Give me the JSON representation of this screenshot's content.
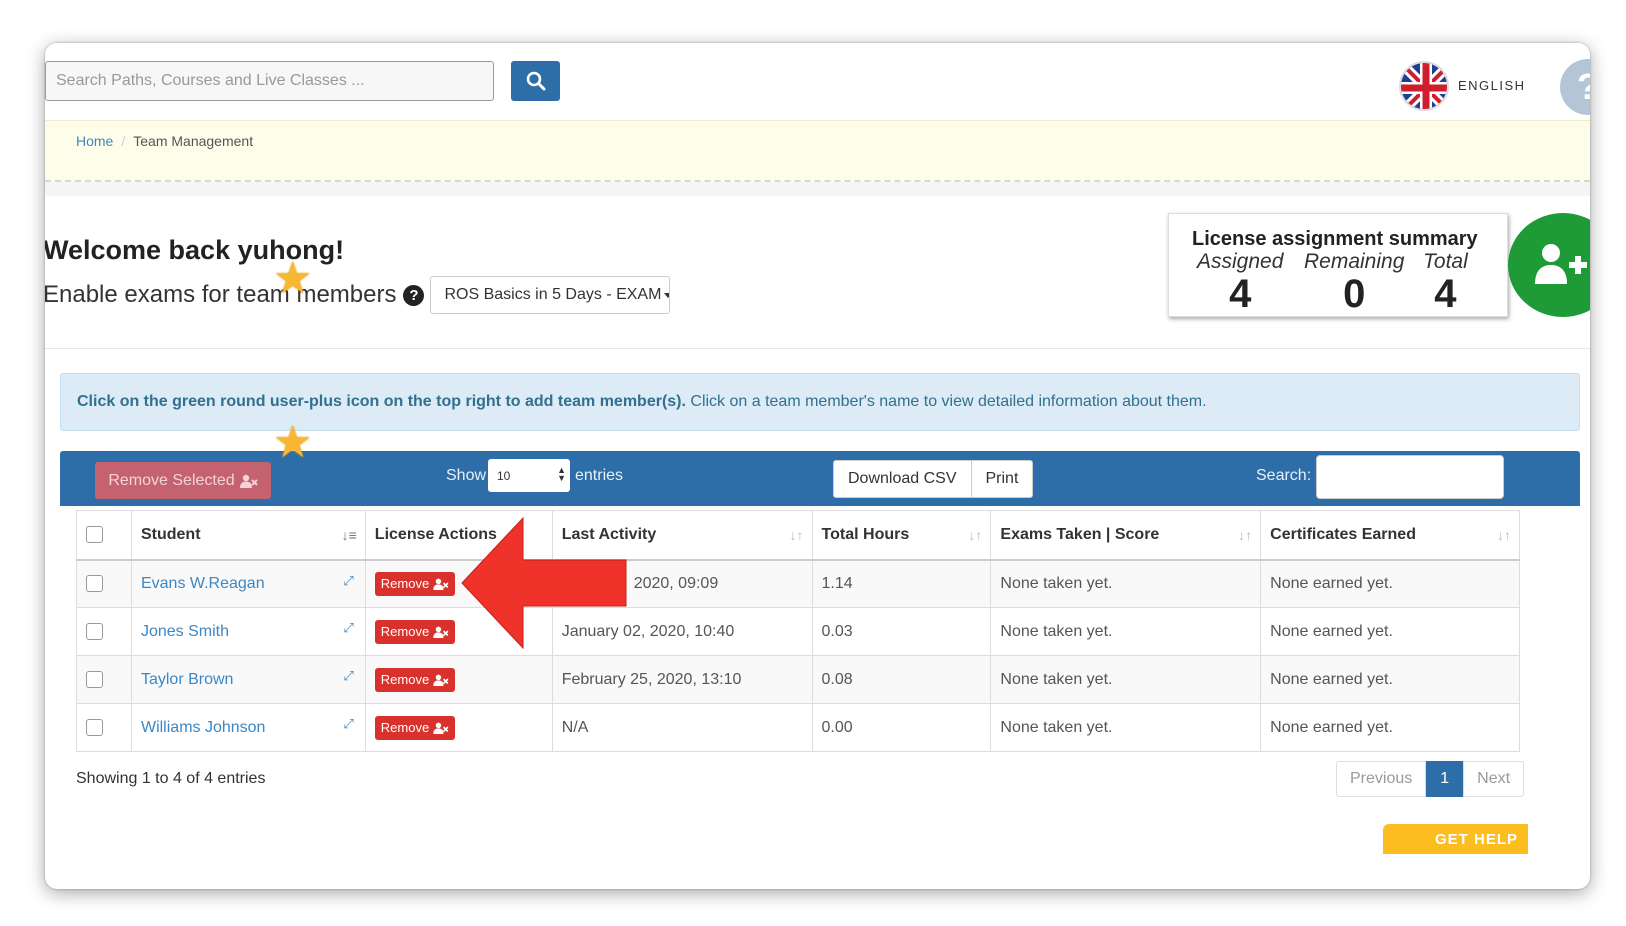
{
  "header": {
    "search_placeholder": "Search Paths, Courses and Live Classes ...",
    "language": "ENGLISH",
    "help_glyph": "?"
  },
  "breadcrumb": {
    "home": "Home",
    "separator": "/",
    "current": "Team Management"
  },
  "welcome": {
    "title": "Welcome back yuhong!",
    "enable_label": "Enable exams for team members",
    "help_glyph": "?",
    "exam_selected": "ROS Basics in 5 Days - EXAM"
  },
  "license_summary": {
    "title": "License assignment summary",
    "assigned_label": "Assigned",
    "assigned_value": "4",
    "remaining_label": "Remaining",
    "remaining_value": "0",
    "total_label": "Total",
    "total_value": "4"
  },
  "info": {
    "bold": "Click on the green round user-plus icon on the top right to add team member(s).",
    "text": " Click on a team member's name to view detailed information about them."
  },
  "toolbar": {
    "remove_selected": "Remove Selected",
    "show_label": "Show",
    "entries_value": "10",
    "entries_label": "entries",
    "download_csv": "Download CSV",
    "print": "Print",
    "search_label": "Search:"
  },
  "table": {
    "columns": [
      "Student",
      "License Actions",
      "Last Activity",
      "Total Hours",
      "Exams Taken | Score",
      "Certificates Earned"
    ],
    "remove_label": "Remove",
    "rows": [
      {
        "student": "Evans W.Reagan",
        "last_activity": "2020, 09:09",
        "hours": "1.14",
        "exams": "None taken yet.",
        "certs": "None earned yet."
      },
      {
        "student": "Jones Smith",
        "last_activity": "January 02, 2020, 10:40",
        "hours": "0.03",
        "exams": "None taken yet.",
        "certs": "None earned yet."
      },
      {
        "student": "Taylor Brown",
        "last_activity": "February 25, 2020, 13:10",
        "hours": "0.08",
        "exams": "None taken yet.",
        "certs": "None earned yet."
      },
      {
        "student": "Williams Johnson",
        "last_activity": "N/A",
        "hours": "0.00",
        "exams": "None taken yet.",
        "certs": "None earned yet."
      }
    ]
  },
  "footer": {
    "showing": "Showing 1 to 4 of 4 entries",
    "previous": "Previous",
    "page": "1",
    "next": "Next",
    "get_help": "GET HELP"
  },
  "colors": {
    "primary": "#2d6ea8",
    "success": "#1e9a36",
    "danger": "#d9322c",
    "warning": "#fcbd21"
  }
}
